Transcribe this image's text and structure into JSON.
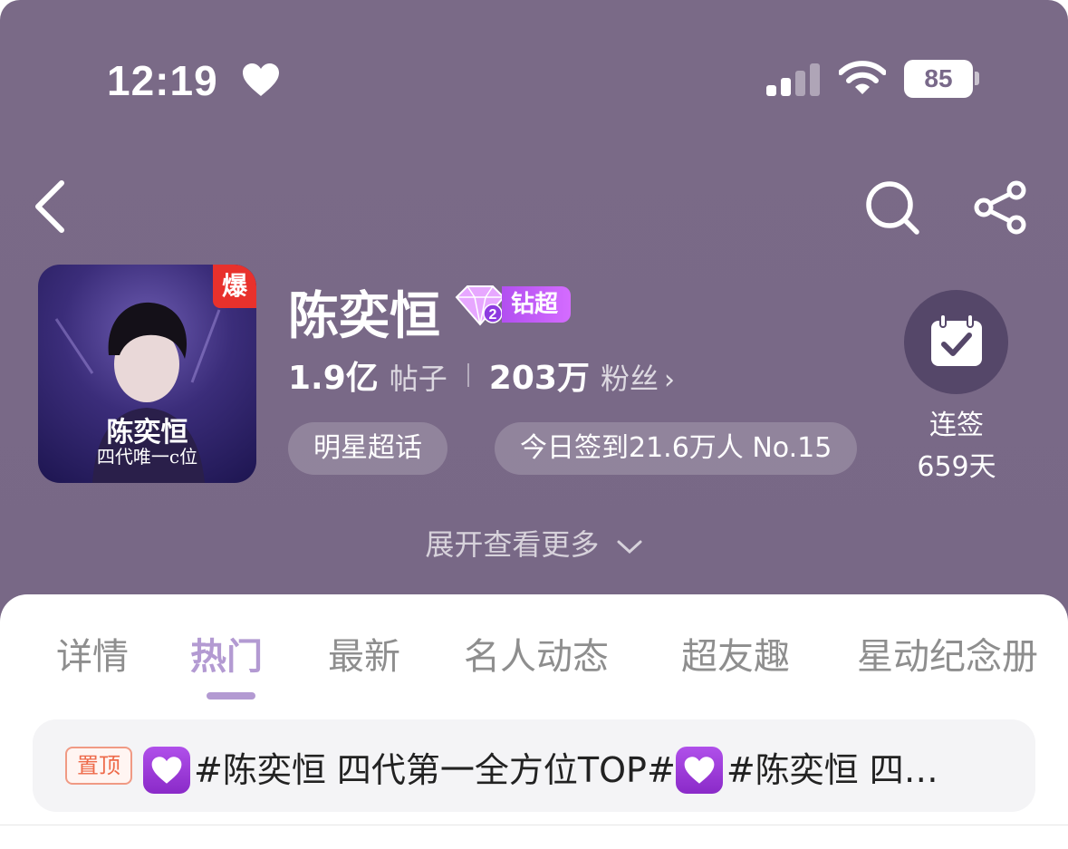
{
  "status_bar": {
    "time": "12:19",
    "battery": "85"
  },
  "header": {
    "back_icon": "chevron-left-icon",
    "search_icon": "search-icon",
    "share_icon": "share-icon"
  },
  "profile": {
    "avatar": {
      "hot_badge": "爆",
      "name": "陈奕恒",
      "subtitle": "四代唯一c位"
    },
    "name": "陈奕恒",
    "rank_badge": "钻超",
    "posts_count": "1.9亿",
    "posts_label": "帖子",
    "fans_count": "203万",
    "fans_label": "粉丝",
    "fans_chevron": "›",
    "category_chip": "明星超话",
    "checkin_chip": "今日签到21.6万人 No.15",
    "checkin_button_label": "连签",
    "checkin_days": "659天",
    "expand_more": "展开查看更多"
  },
  "tabs": [
    {
      "label": "详情",
      "active": false
    },
    {
      "label": "热门",
      "active": true
    },
    {
      "label": "最新",
      "active": false
    },
    {
      "label": "名人动态",
      "active": false
    },
    {
      "label": "超友趣",
      "active": false
    },
    {
      "label": "星动纪念册",
      "active": false
    }
  ],
  "pinned_post": {
    "badge": "置顶",
    "text_1": "#陈奕恒 四代第一全方位TOP#",
    "text_2": "#陈奕恒 四…"
  },
  "colors": {
    "header_bg": "#7a6a87",
    "active_tab": "#b39ad2",
    "pin_badge": "#ee6a4a",
    "hot_badge": "#e8312c"
  }
}
